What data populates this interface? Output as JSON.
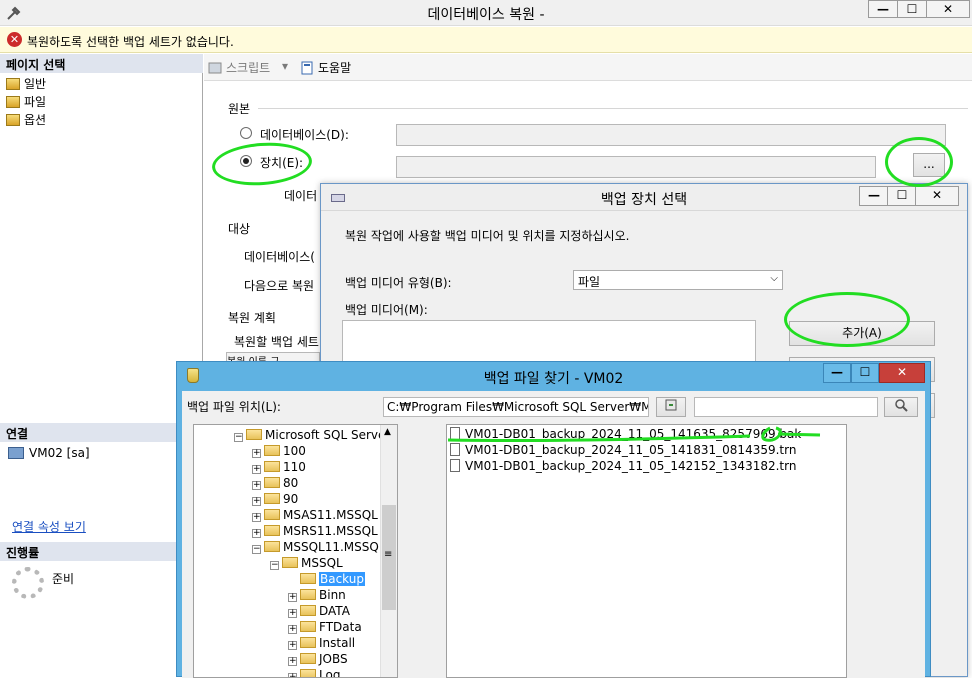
{
  "main": {
    "title": "데이터베이스 복원 -",
    "error": "복원하도록 선택한 백업 세트가 없습니다.",
    "buttons": {
      "minimize": "—",
      "maximize": "☐",
      "close": "✕"
    }
  },
  "left_pane": {
    "page_select_header": "페이지 선택",
    "pages": [
      "일반",
      "파일",
      "옵션"
    ],
    "connection_header": "연결",
    "connection_item": "VM02 [sa]",
    "connection_link": "연결 속성 보기",
    "progress_header": "진행률",
    "progress_status": "준비"
  },
  "toolbar": {
    "script": "스크립트",
    "script_arrow": "▾",
    "help": "도움말"
  },
  "general": {
    "source_label": "원본",
    "database_option": "데이터베이스(D):",
    "device_option": "장치(E):",
    "browse_button": "...",
    "database_sub_label": "데이터",
    "destination_label": "대상",
    "dest_database": "데이터베이스(",
    "restore_to": "다음으로 복원",
    "restore_plan": "복원 계획",
    "backup_sets": "복원할 백업 세트",
    "grid_col1": "복원",
    "grid_col2": "이름",
    "grid_col3": "구"
  },
  "device_dialog": {
    "title": "백업 장치 선택",
    "description": "복원 작업에 사용할 백업 미디어 및 위치를 지정하십시오.",
    "media_type_label": "백업 미디어 유형(B):",
    "media_type_value": "파일",
    "media_label": "백업 미디어(M):",
    "add_button": "추가(A)"
  },
  "file_dialog": {
    "title": "백업 파일 찾기 - VM02",
    "location_label": "백업 파일 위치(L):",
    "location_value": "C:₩Program Files₩Microsoft SQL Server₩MS",
    "tree": [
      {
        "label": "Microsoft SQL Serve",
        "exp": "−"
      },
      {
        "label": "100",
        "exp": "+"
      },
      {
        "label": "110",
        "exp": "+"
      },
      {
        "label": "80",
        "exp": "+"
      },
      {
        "label": "90",
        "exp": "+"
      },
      {
        "label": "MSAS11.MSSQL",
        "exp": "+"
      },
      {
        "label": "MSRS11.MSSQL",
        "exp": "+"
      },
      {
        "label": "MSSQL11.MSSQ",
        "exp": "−"
      },
      {
        "label": "MSSQL",
        "exp": "−"
      },
      {
        "label": "Backup",
        "exp": ""
      },
      {
        "label": "Binn",
        "exp": "+"
      },
      {
        "label": "DATA",
        "exp": "+"
      },
      {
        "label": "FTData",
        "exp": "+"
      },
      {
        "label": "Install",
        "exp": "+"
      },
      {
        "label": "JOBS",
        "exp": "+"
      },
      {
        "label": "Log",
        "exp": "+"
      }
    ],
    "files": [
      "VM01-DB01_backup_2024_11_05_141635_8257969.bak",
      "VM01-DB01_backup_2024_11_05_141831_0814359.trn",
      "VM01-DB01_backup_2024_11_05_142152_1343182.trn"
    ],
    "scroll_grip": "≡"
  },
  "colors": {
    "annotation": "#22dd22",
    "title_bar": "#5fb2e2",
    "selection": "#3399ff"
  }
}
